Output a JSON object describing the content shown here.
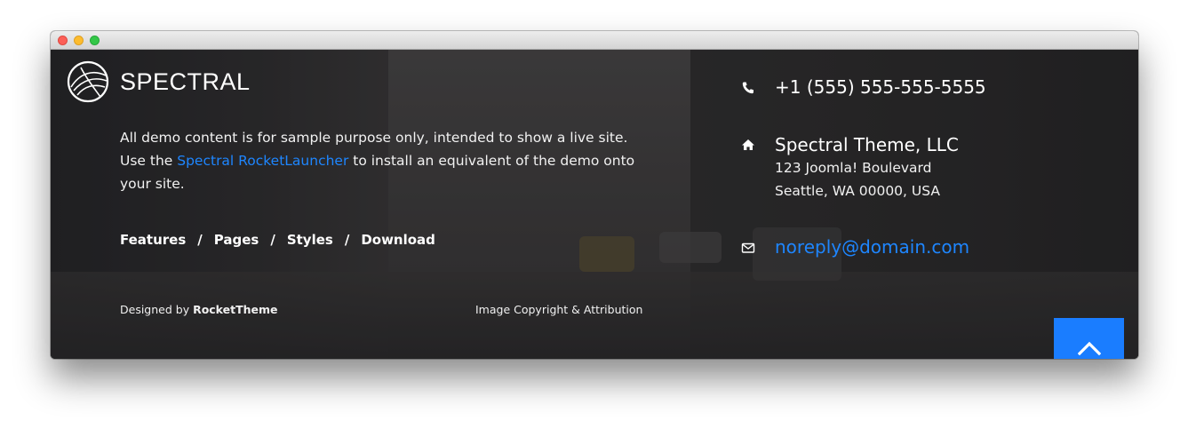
{
  "brand": {
    "name": "SPECTRAL"
  },
  "about": {
    "text_before": "All demo content is for sample purpose only, intended to show a live site. Use the ",
    "link": "Spectral RocketLauncher",
    "text_after": " to install an equivalent of the demo onto your site."
  },
  "nav": {
    "items": [
      "Features",
      "Pages",
      "Styles",
      "Download"
    ],
    "separator": "/"
  },
  "footer": {
    "designed_prefix": "Designed by ",
    "designed_by": "RocketTheme",
    "image_credit": "Image Copyright & Attribution"
  },
  "contact": {
    "phone": "+1 (555) 555-555-5555",
    "company": "Spectral Theme, LLC",
    "street": "123 Joomla! Boulevard",
    "city": "Seattle, WA 00000, USA",
    "email": "noreply@domain.com"
  },
  "icons": {
    "phone": "phone-icon",
    "home": "home-icon",
    "mail": "envelope-icon",
    "top": "chevron-up-icon"
  },
  "colors": {
    "accent": "#1a7dff",
    "link": "#1e86ff",
    "text": "#ffffff"
  }
}
